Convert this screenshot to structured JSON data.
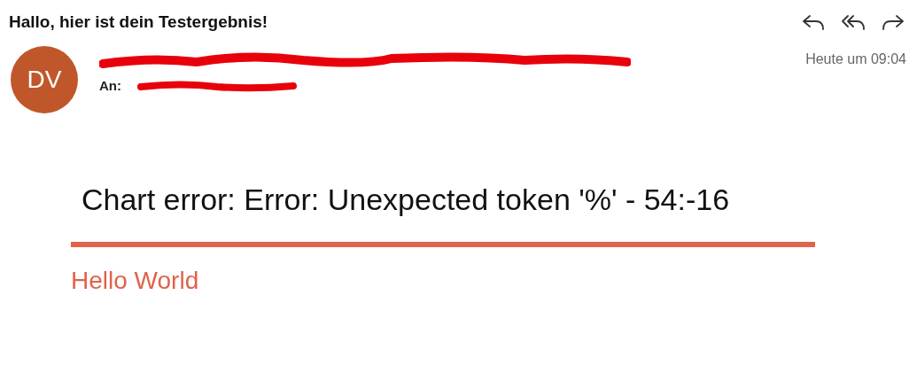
{
  "message": {
    "subject": "Hallo, hier ist dein Testergebnis!",
    "avatar_initials": "DV",
    "to_label": "An:",
    "time": "Heute um 09:04"
  },
  "body": {
    "error": "Chart error: Error: Unexpected token '%' - 54:-16",
    "heading": "Hello World"
  }
}
